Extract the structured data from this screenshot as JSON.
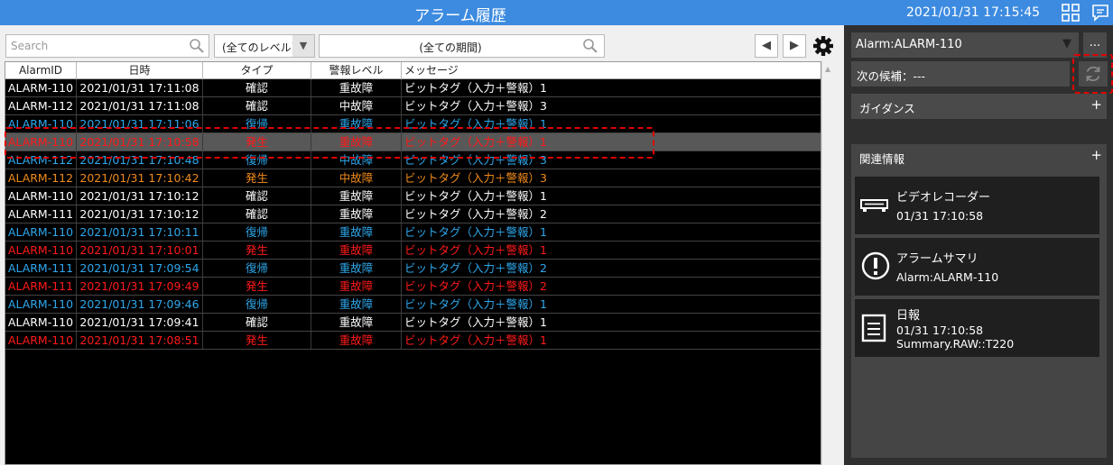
{
  "titlebar": {
    "title": "アラーム履歴",
    "datetime": "2021/01/31 17:15:45",
    "icons": [
      "grid-layout-icon",
      "message-icon"
    ]
  },
  "toolbar": {
    "search_placeholder": "Search",
    "level_value": "(全てのレベル)",
    "period_value": "(全ての期間)",
    "icons": [
      "search-icon",
      "dropdown-arrow-icon",
      "prev-arrow-icon",
      "next-arrow-icon",
      "gear-icon"
    ]
  },
  "table": {
    "headers": [
      "AlarmID",
      "日時",
      "タイプ",
      "警報レベル",
      "メッセージ"
    ],
    "rows": [
      {
        "id": "ALARM-110",
        "time": "2021/01/31 17:11:08",
        "type": "確認",
        "level": "重故障",
        "msg": "ビットタグ（入力＋警報）1",
        "color": "white"
      },
      {
        "id": "ALARM-112",
        "time": "2021/01/31 17:11:08",
        "type": "確認",
        "level": "中故障",
        "msg": "ビットタグ（入力＋警報）3",
        "color": "white"
      },
      {
        "id": "ALARM-110",
        "time": "2021/01/31 17:11:06",
        "type": "復帰",
        "level": "重故障",
        "msg": "ビットタグ（入力＋警報）1",
        "color": "blue"
      },
      {
        "id": "ALARM-110",
        "time": "2021/01/31 17:10:58",
        "type": "発生",
        "level": "重故障",
        "msg": "ビットタグ（入力＋警報）1",
        "color": "red",
        "selected": true
      },
      {
        "id": "ALARM-112",
        "time": "2021/01/31 17:10:48",
        "type": "復帰",
        "level": "中故障",
        "msg": "ビットタグ（入力＋警報）3",
        "color": "blue"
      },
      {
        "id": "ALARM-112",
        "time": "2021/01/31 17:10:42",
        "type": "発生",
        "level": "中故障",
        "msg": "ビットタグ（入力＋警報）3",
        "color": "orange"
      },
      {
        "id": "ALARM-110",
        "time": "2021/01/31 17:10:12",
        "type": "確認",
        "level": "重故障",
        "msg": "ビットタグ（入力＋警報）1",
        "color": "white"
      },
      {
        "id": "ALARM-111",
        "time": "2021/01/31 17:10:12",
        "type": "確認",
        "level": "重故障",
        "msg": "ビットタグ（入力＋警報）2",
        "color": "white"
      },
      {
        "id": "ALARM-110",
        "time": "2021/01/31 17:10:11",
        "type": "復帰",
        "level": "重故障",
        "msg": "ビットタグ（入力＋警報）1",
        "color": "blue"
      },
      {
        "id": "ALARM-110",
        "time": "2021/01/31 17:10:01",
        "type": "発生",
        "level": "重故障",
        "msg": "ビットタグ（入力＋警報）1",
        "color": "red"
      },
      {
        "id": "ALARM-111",
        "time": "2021/01/31 17:09:54",
        "type": "復帰",
        "level": "重故障",
        "msg": "ビットタグ（入力＋警報）2",
        "color": "blue"
      },
      {
        "id": "ALARM-111",
        "time": "2021/01/31 17:09:49",
        "type": "発生",
        "level": "重故障",
        "msg": "ビットタグ（入力＋警報）2",
        "color": "red"
      },
      {
        "id": "ALARM-110",
        "time": "2021/01/31 17:09:46",
        "type": "復帰",
        "level": "重故障",
        "msg": "ビットタグ（入力＋警報）1",
        "color": "blue"
      },
      {
        "id": "ALARM-110",
        "time": "2021/01/31 17:09:41",
        "type": "確認",
        "level": "重故障",
        "msg": "ビットタグ（入力＋警報）1",
        "color": "white"
      },
      {
        "id": "ALARM-110",
        "time": "2021/01/31 17:08:51",
        "type": "発生",
        "level": "重故障",
        "msg": "ビットタグ（入力＋警報）1",
        "color": "red"
      }
    ]
  },
  "side": {
    "alarm_select": "Alarm:ALARM-110",
    "more_label": "...",
    "next_candidate": "次の候補：---",
    "guidance": "ガイダンス",
    "related": "関連情報",
    "plus": "+",
    "cards": [
      {
        "icon": "video-recorder-icon",
        "title": "ビデオレコーダー",
        "line1": "01/31 17:10:58",
        "line2": ""
      },
      {
        "icon": "alarm-summary-icon",
        "title": "アラームサマリ",
        "line1": "Alarm:ALARM-110",
        "line2": ""
      },
      {
        "icon": "daily-report-icon",
        "title": "日報",
        "line1": "01/31 17:10:58",
        "line2": "Summary.RAW::T220"
      }
    ]
  },
  "colors": {
    "titlebar": "#3d8be0",
    "white": "#ffffff",
    "blue": "#2ea8ec",
    "red": "#ff1a1a",
    "orange": "#f08b1a",
    "highlight": "#e00000"
  }
}
